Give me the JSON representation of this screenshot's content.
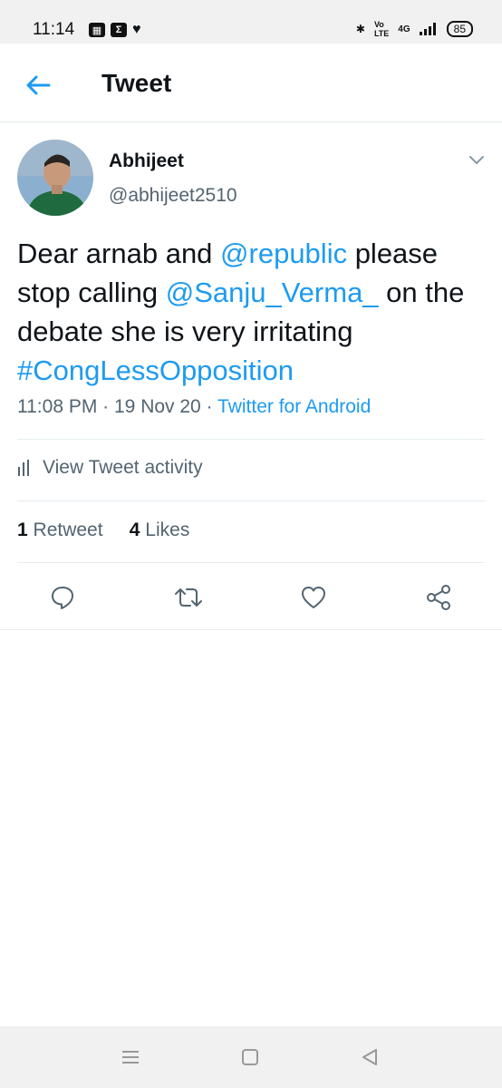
{
  "status_bar": {
    "time": "11:14",
    "network": "4G",
    "battery": "85"
  },
  "header": {
    "title": "Tweet"
  },
  "tweet": {
    "author_name": "Abhijeet",
    "author_handle": "@abhijeet2510",
    "text_parts": {
      "p1": "Dear arnab and ",
      "mention1": "@republic",
      "p2": " please stop calling ",
      "mention2": "@Sanju_Verma_",
      "p3": " on the debate she is very irritating ",
      "hashtag": "#CongLessOpposition"
    },
    "time": "11:08 PM",
    "date": "19 Nov 20",
    "source": "Twitter for Android",
    "activity_label": "View Tweet activity",
    "retweets_count": "1",
    "retweets_label": "Retweet",
    "likes_count": "4",
    "likes_label": "Likes"
  },
  "colors": {
    "accent": "#1d9bf0",
    "secondary_text": "#536471",
    "divider": "#e6ecf0"
  },
  "icons": [
    "back-arrow-icon",
    "chevron-down-icon",
    "reply-icon",
    "retweet-icon",
    "like-icon",
    "share-icon",
    "bar-chart-icon",
    "nav-menu-icon",
    "nav-home-icon",
    "nav-back-icon"
  ]
}
